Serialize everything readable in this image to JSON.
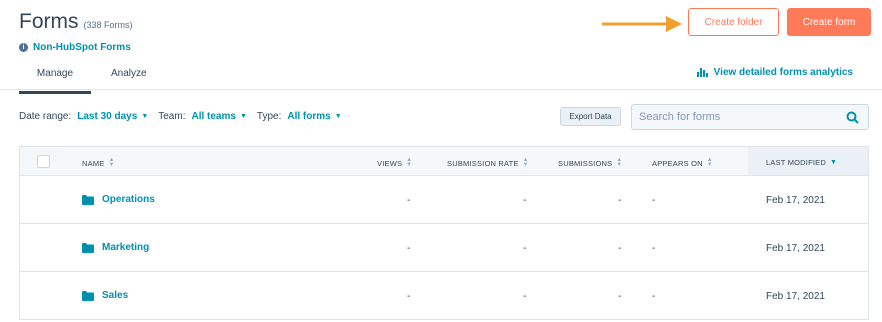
{
  "header": {
    "title": "Forms",
    "count": "(338 Forms)",
    "sub_link": "Non-HubSpot Forms"
  },
  "buttons": {
    "create_folder": "Create folder",
    "create_form": "Create form"
  },
  "tabs": [
    {
      "label": "Manage",
      "active": true
    },
    {
      "label": "Analyze",
      "active": false
    }
  ],
  "analytics_link": "View detailed forms analytics",
  "filters": {
    "date_label": "Date range:",
    "date_value": "Last 30 days",
    "team_label": "Team:",
    "team_value": "All teams",
    "type_label": "Type:",
    "type_value": "All forms"
  },
  "export_label": "Export Data",
  "search": {
    "placeholder": "Search for forms"
  },
  "table": {
    "columns": [
      "NAME",
      "VIEWS",
      "SUBMISSION RATE",
      "SUBMISSIONS",
      "APPEARS ON",
      "LAST MODIFIED"
    ],
    "rows": [
      {
        "name": "Operations",
        "views": "-",
        "rate": "-",
        "submissions": "-",
        "appears": "-",
        "modified": "Feb 17, 2021"
      },
      {
        "name": "Marketing",
        "views": "-",
        "rate": "-",
        "submissions": "-",
        "appears": "-",
        "modified": "Feb 17, 2021"
      },
      {
        "name": "Sales",
        "views": "-",
        "rate": "-",
        "submissions": "-",
        "appears": "-",
        "modified": "Feb 17, 2021"
      }
    ]
  },
  "colors": {
    "accent": "#ff7a59",
    "link": "#0091ae",
    "text": "#33475b",
    "annotation_arrow": "#f0a030"
  },
  "icons": {
    "info": "info-icon",
    "chart": "bar-chart-icon",
    "search": "search-icon",
    "folder": "folder-icon",
    "arrow": "arrow-right-icon"
  }
}
